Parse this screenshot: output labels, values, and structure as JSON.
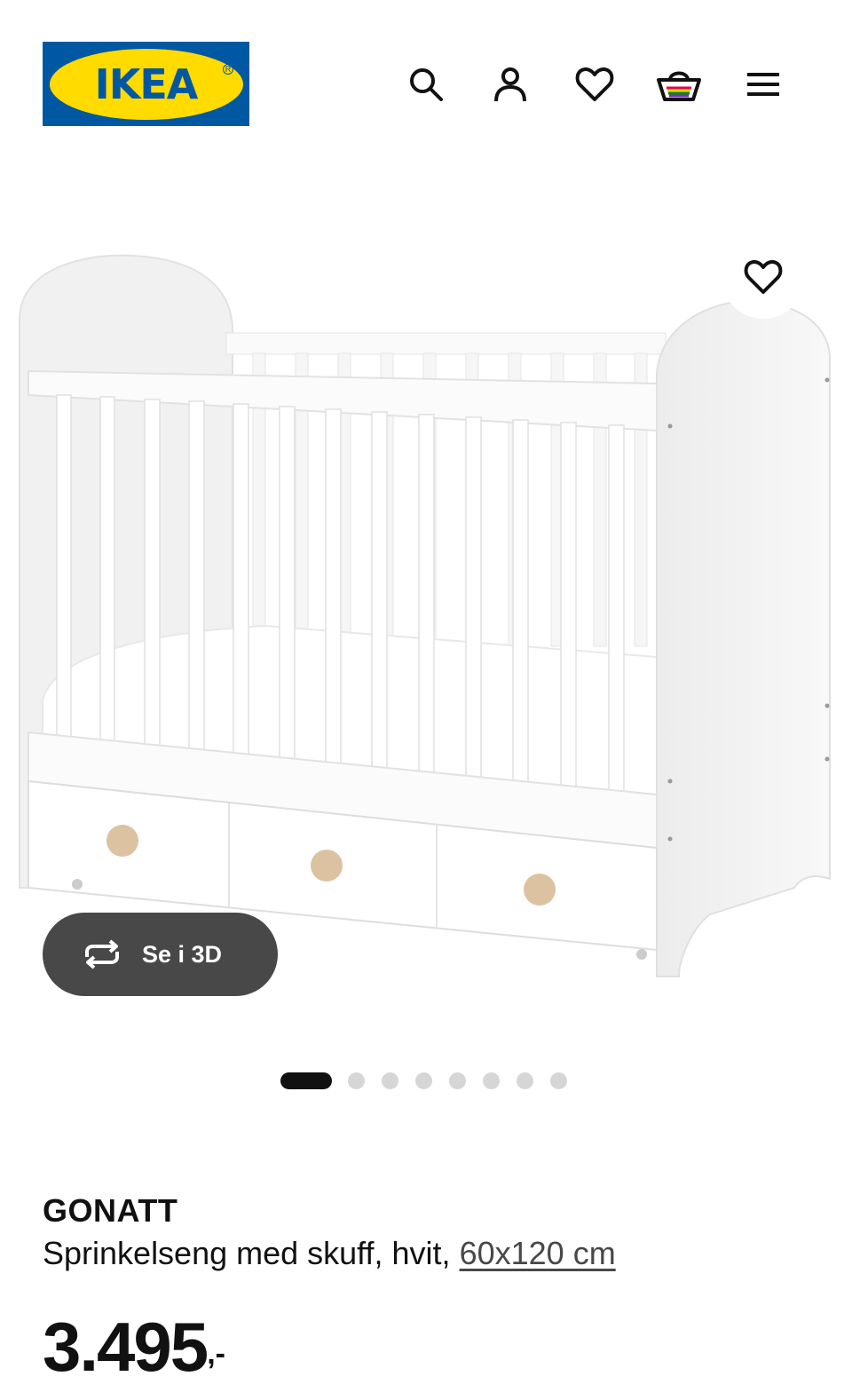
{
  "brand": {
    "logo_text": "IKEA",
    "primary_color": "#0058a3",
    "secondary_color": "#ffdb00"
  },
  "nav": {
    "icons": [
      "search-icon",
      "account-icon",
      "favourites-icon",
      "shopping-bag-icon",
      "menu-icon"
    ]
  },
  "gallery": {
    "view_3d_label": "Se i 3D",
    "dot_count": 8,
    "active_index": 0
  },
  "product": {
    "name": "GONATT",
    "description": "Sprinkelseng med skuff, hvit,",
    "size_link": "60x120 cm",
    "price_integer": "3.495",
    "price_decimal": ",-"
  }
}
